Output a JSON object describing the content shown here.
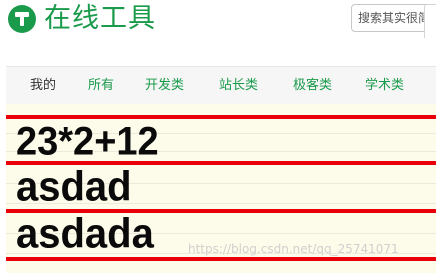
{
  "header": {
    "logo_icon": "hammer-icon",
    "brand_color": "#1a9a4b",
    "title": "在线工具",
    "search_placeholder": "搜索其实很简单"
  },
  "nav": {
    "tabs": [
      {
        "label": "我的",
        "color": "#333333"
      },
      {
        "label": "所有",
        "color": "#1a9a4b"
      },
      {
        "label": "开发类",
        "color": "#1a9a4b"
      },
      {
        "label": "站长类",
        "color": "#1a9a4b"
      },
      {
        "label": "极客类",
        "color": "#1a9a4b"
      },
      {
        "label": "学术类",
        "color": "#1a9a4b"
      }
    ]
  },
  "content": {
    "background": "#fdfbea",
    "line_color": "#e8000b",
    "lines": [
      "23*2+12",
      "asdad",
      "asdada"
    ],
    "watermark": "https://blog.csdn.net/qq_25741071"
  }
}
